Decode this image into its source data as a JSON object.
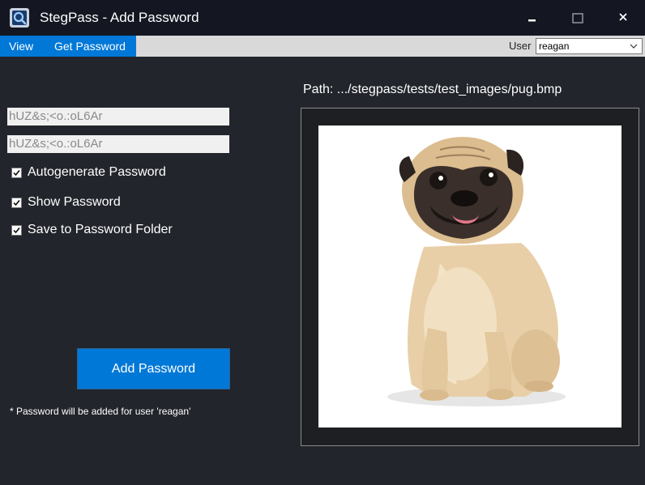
{
  "window": {
    "title": "StegPass - Add Password",
    "controls": [
      "minimize-icon",
      "maximize-icon",
      "close-icon"
    ]
  },
  "menu": {
    "items": [
      {
        "label": "View"
      },
      {
        "label": "Get Password"
      }
    ]
  },
  "user": {
    "label": "User",
    "selected": "reagan"
  },
  "form": {
    "password_value": "hUZ&s;<o.:oL6Ar",
    "confirm_value": "hUZ&s;<o.:oL6Ar",
    "checkboxes": [
      {
        "label": "Autogenerate Password",
        "checked": true
      },
      {
        "label": "Show Password",
        "checked": true
      },
      {
        "label": "Save to Password Folder",
        "checked": true
      }
    ],
    "add_button_label": "Add Password",
    "note": "* Password will be added for user 'reagan'"
  },
  "image_panel": {
    "path": "Path: .../stegpass/tests/test_images/pug.bmp",
    "image_subject": "pug-dog-image"
  },
  "colors": {
    "titlebar": "#141722",
    "background": "#22252b",
    "accent": "#0078d7",
    "menubar": "#d9d9d9"
  }
}
